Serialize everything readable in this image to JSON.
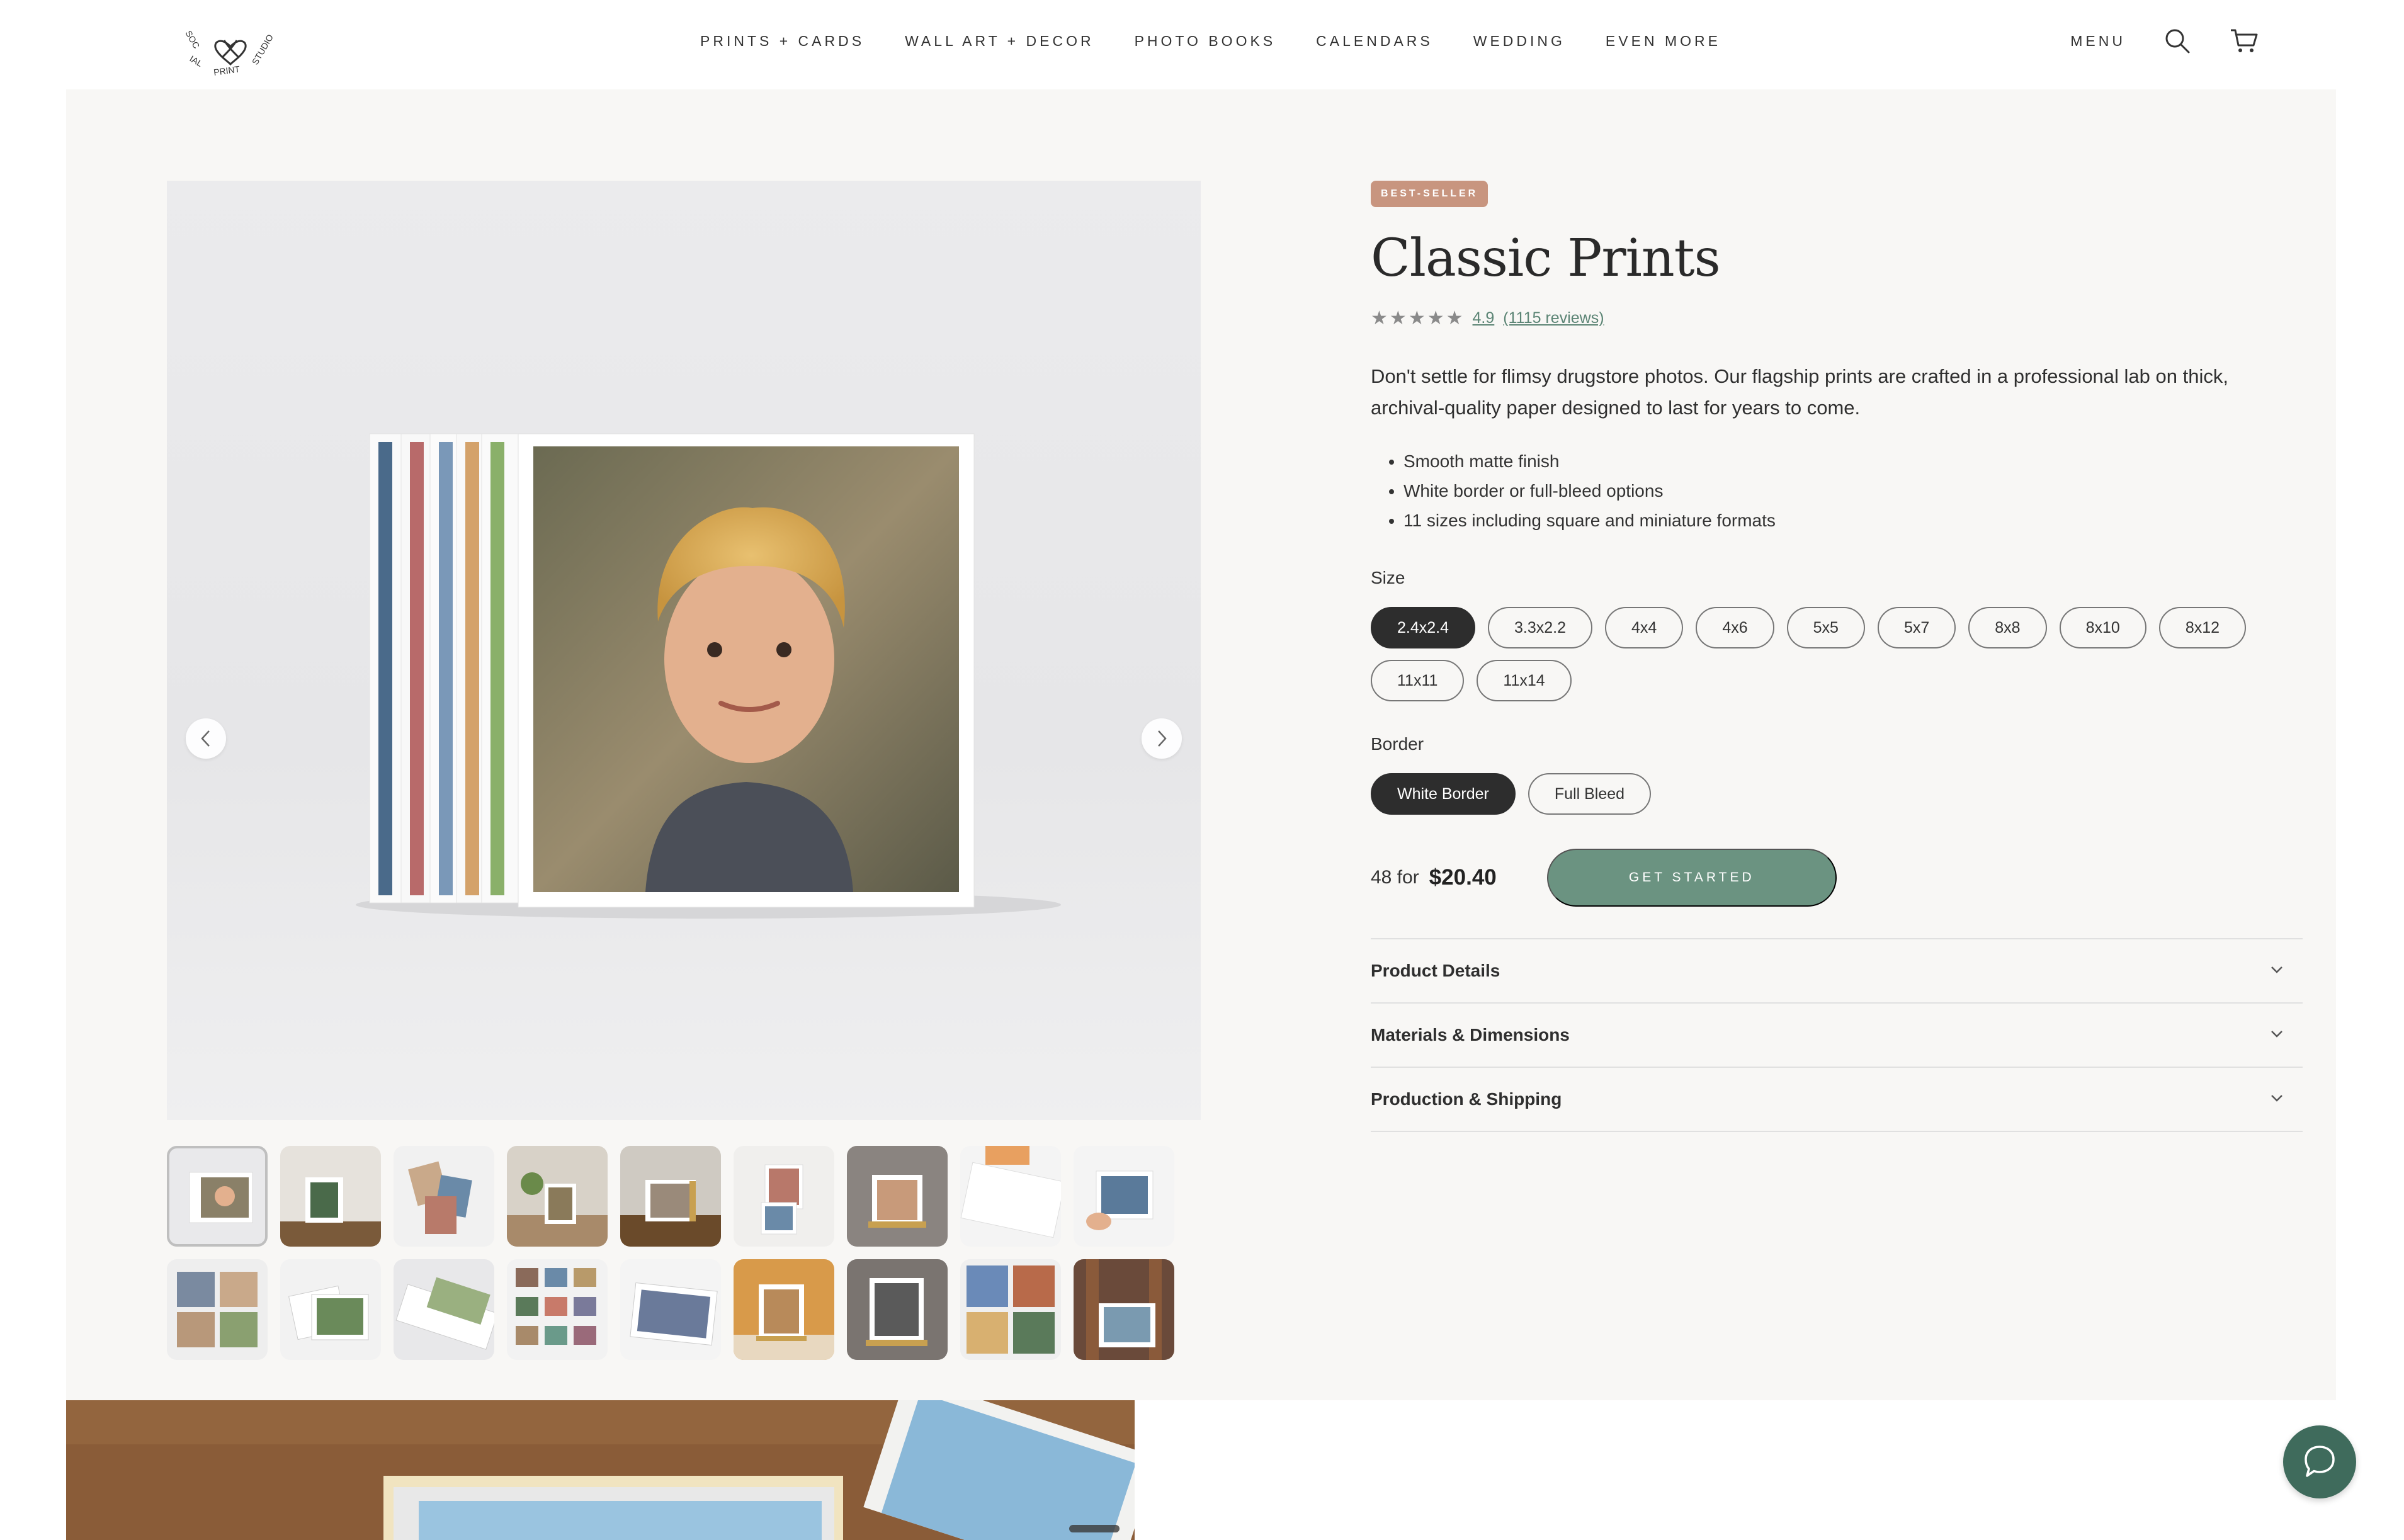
{
  "brand": {
    "logo_text": "SOCIAL PRINT STUDIO"
  },
  "nav": {
    "items": [
      "PRINTS + CARDS",
      "WALL ART + DECOR",
      "PHOTO BOOKS",
      "CALENDARS",
      "WEDDING",
      "EVEN MORE"
    ],
    "menu_label": "MENU",
    "icons": [
      "search-icon",
      "cart-icon"
    ]
  },
  "product": {
    "badge": "BEST-SELLER",
    "title": "Classic Prints",
    "rating_value": "4.9",
    "reviews_text": "(1115 reviews)",
    "stars": 5,
    "description": "Don't settle for flimsy drugstore photos. Our flagship prints are crafted in a professional lab on thick, archival-quality paper designed to last for years to come.",
    "features": [
      "Smooth matte finish",
      "White border or full-bleed options",
      "11 sizes including square and miniature formats"
    ],
    "size_label": "Size",
    "sizes": [
      "2.4x2.4",
      "3.3x2.2",
      "4x4",
      "4x6",
      "5x5",
      "5x7",
      "8x8",
      "8x10",
      "8x12",
      "11x11",
      "11x14"
    ],
    "selected_size": "2.4x2.4",
    "border_label": "Border",
    "borders": [
      "White Border",
      "Full Bleed"
    ],
    "selected_border": "White Border",
    "price_qty": "48 for",
    "price": "$20.40",
    "cta_label": "GET STARTED"
  },
  "accordion": {
    "items": [
      "Product Details",
      "Materials & Dimensions",
      "Production & Shipping"
    ]
  },
  "gallery": {
    "thumbnail_count": 18,
    "active_index": 0
  },
  "colors": {
    "accent_green": "#6b9381",
    "badge_bg": "#c8957f",
    "selected_pill": "#2d2d2d",
    "help_bubble": "#3f6b5c"
  }
}
